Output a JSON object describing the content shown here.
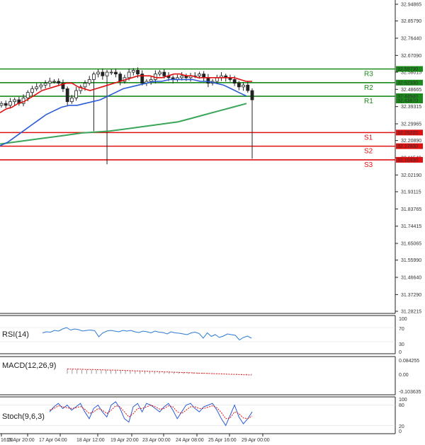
{
  "chart_data": {
    "type": "candlestick",
    "main": {
      "y_ticks": [
        "32.94865",
        "32.85790",
        "32.76440",
        "32.67090",
        "32.58015",
        "32.48665",
        "32.39315",
        "32.29965",
        "32.20890",
        "32.11540",
        "32.02190",
        "31.93115",
        "31.83765",
        "31.74415",
        "31.65065",
        "31.55990",
        "31.46640",
        "31.37290",
        "31.28215"
      ],
      "ylim": [
        31.28215,
        32.94865
      ],
      "x_ticks": [
        "16:00",
        "15 Apr 20:00",
        "17 Apr 04:00",
        "18 Apr 12:00",
        "19 Apr 20:00",
        "23 Apr 00:00",
        "24 Apr 08:00",
        "25 Apr 16:00",
        "29 Apr 00:00"
      ],
      "levels": [
        {
          "name": "R3",
          "value": 32.5973,
          "label": "32.59730",
          "color": "#1a8a1a"
        },
        {
          "name": "R2",
          "value": 32.5233,
          "label": "32.52330",
          "color": "#1a8a1a"
        },
        {
          "name": "R1",
          "value": 32.4494,
          "label": "32.44940",
          "color": "#1a8a1a"
        },
        {
          "name": "S1",
          "value": 32.2522,
          "label": "32.25220",
          "color": "#e01010"
        },
        {
          "name": "S2",
          "value": 32.1783,
          "label": "32.17830",
          "color": "#e01010"
        },
        {
          "name": "S3",
          "value": 32.1043,
          "label": "32.10430",
          "color": "#e01010"
        }
      ],
      "extra_price_label": "32.43870",
      "close_series": [
        32.41,
        32.4,
        32.42,
        32.43,
        32.41,
        32.44,
        32.47,
        32.49,
        32.5,
        32.51,
        32.52,
        32.53,
        32.53,
        32.52,
        32.49,
        32.42,
        32.44,
        32.48,
        32.5,
        32.52,
        32.54,
        32.57,
        32.58,
        32.56,
        32.58,
        32.58,
        32.57,
        32.53,
        32.55,
        32.58,
        32.59,
        32.57,
        32.52,
        32.53,
        32.54,
        32.57,
        32.58,
        32.56,
        32.55,
        32.54,
        32.55,
        32.56,
        32.55,
        32.56,
        32.56,
        32.57,
        32.55,
        32.52,
        32.53,
        32.55,
        32.56,
        32.55,
        32.54,
        32.52,
        32.5,
        32.51,
        32.48,
        32.43
      ],
      "ma_red": [
        32.36,
        32.38,
        32.39,
        32.41,
        32.42,
        32.44,
        32.46,
        32.48,
        32.49,
        32.5,
        32.51,
        32.52,
        32.52,
        32.5,
        32.49,
        32.48,
        32.49,
        32.5,
        32.51,
        32.52,
        32.53,
        32.54,
        32.55,
        32.56,
        32.56,
        32.56,
        32.55,
        32.55,
        32.56,
        32.57,
        32.57,
        32.56,
        32.56,
        32.55,
        32.55,
        32.55,
        32.55,
        32.55,
        32.55,
        32.55,
        32.54,
        32.53,
        32.53
      ],
      "ma_blue": [
        32.18,
        32.2,
        32.23,
        32.26,
        32.29,
        32.32,
        32.35,
        32.37,
        32.39,
        32.4,
        32.4,
        32.41,
        32.42,
        32.43,
        32.45,
        32.47,
        32.49,
        32.5,
        32.51,
        32.52,
        32.53,
        32.53,
        32.54,
        32.54,
        32.54,
        32.54,
        32.53,
        32.53,
        32.52,
        32.51,
        32.49,
        32.47,
        32.45
      ],
      "ma_green": [
        32.19,
        32.2,
        32.21,
        32.22,
        32.23,
        32.24,
        32.25,
        32.255,
        32.26,
        32.27,
        32.28,
        32.29,
        32.3,
        32.31,
        32.33,
        32.35,
        32.37,
        32.39,
        32.41
      ],
      "colors": {
        "bull": "#1a8a1a",
        "bear": "#e01010",
        "ma_red": "#e01010",
        "ma_blue": "#2a5bd7",
        "ma_green": "#3aa65a"
      }
    },
    "rsi": {
      "title": "RSI(14)",
      "y_ticks": [
        "100",
        "70",
        "30",
        "0"
      ],
      "values": [
        55,
        58,
        57,
        62,
        60,
        66,
        70,
        63,
        66,
        64,
        60,
        62,
        63,
        61,
        44,
        55,
        60,
        62,
        60,
        58,
        62,
        60,
        62,
        58,
        56,
        60,
        58,
        55,
        60,
        57,
        56,
        52,
        58,
        55,
        54,
        52,
        50,
        55,
        57,
        53,
        40,
        55,
        45,
        50,
        42,
        46,
        52,
        50,
        48,
        35,
        42,
        46,
        40
      ],
      "color": "#2a7ad7"
    },
    "macd": {
      "title": "MACD(12,26,9)",
      "y_ticks": [
        "0.084255",
        "0.00",
        "-0.103635"
      ],
      "ylim": [
        -0.103635,
        0.084255
      ],
      "histogram": [
        0.025,
        0.024,
        0.024,
        0.023,
        0.023,
        0.022,
        0.022,
        0.021,
        0.021,
        0.02,
        0.02,
        0.019,
        0.018,
        0.018,
        0.017,
        0.016,
        0.015,
        0.015,
        0.014,
        0.013,
        0.012,
        0.012,
        0.011,
        0.01,
        0.009,
        0.008,
        0.007,
        0.006,
        0.005,
        0.004,
        0.003,
        0.002,
        0.001,
        0.0,
        -0.001,
        -0.002,
        -0.003,
        -0.004,
        -0.005
      ],
      "signal": [
        0.026,
        0.025,
        0.025,
        0.024,
        0.023,
        0.023,
        0.022,
        0.021,
        0.02,
        0.02,
        0.019,
        0.018,
        0.017,
        0.016,
        0.015,
        0.014,
        0.013,
        0.012,
        0.011,
        0.01,
        0.009,
        0.008,
        0.007,
        0.006,
        0.005,
        0.004,
        0.003,
        0.002,
        0.001,
        0.0,
        -0.001,
        -0.002,
        -0.003,
        -0.004,
        -0.005,
        -0.006
      ],
      "colors": {
        "histogram": "#999999",
        "signal": "#e01010"
      }
    },
    "stoch": {
      "title": "Stoch(9,6,3)",
      "y_ticks": [
        "100",
        "80",
        "20",
        "0"
      ],
      "main_line": [
        60,
        75,
        85,
        70,
        80,
        65,
        75,
        85,
        60,
        40,
        70,
        80,
        60,
        45,
        80,
        90,
        70,
        40,
        30,
        75,
        85,
        60,
        85,
        80,
        70,
        60,
        75,
        85,
        65,
        40,
        60,
        80,
        85,
        70,
        60,
        75,
        80,
        85,
        65,
        40,
        20,
        50,
        80,
        45,
        25,
        40,
        60
      ],
      "signal_line": [
        65,
        70,
        78,
        75,
        72,
        70,
        72,
        76,
        68,
        55,
        60,
        70,
        65,
        55,
        65,
        78,
        75,
        60,
        45,
        55,
        70,
        70,
        75,
        80,
        75,
        68,
        70,
        78,
        75,
        60,
        55,
        65,
        75,
        75,
        70,
        70,
        74,
        78,
        72,
        58,
        40,
        42,
        60,
        55,
        42,
        40,
        48
      ],
      "colors": {
        "main": "#2a5bd7",
        "signal": "#e01010"
      }
    }
  }
}
